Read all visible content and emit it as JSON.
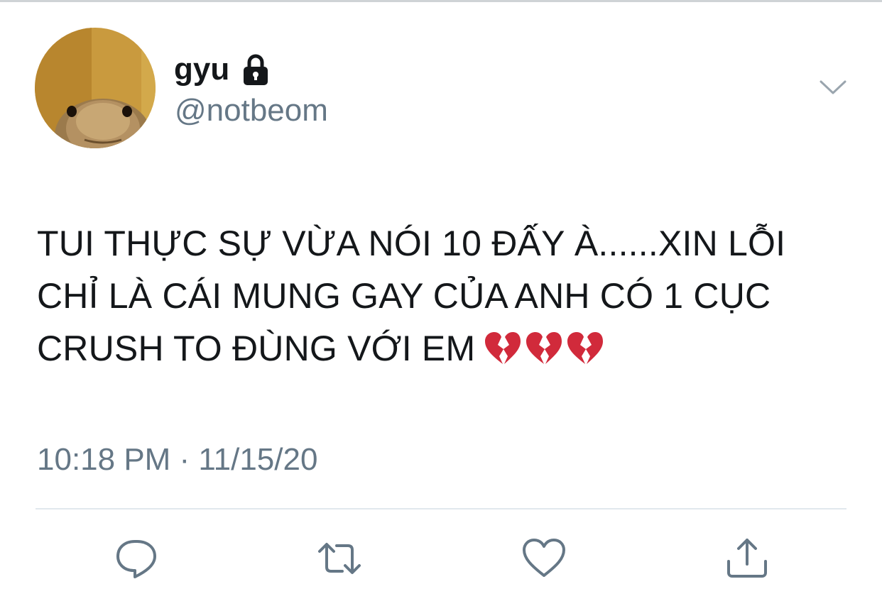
{
  "user": {
    "display_name": "gyu",
    "handle": "@notbeom",
    "protected": true,
    "avatar": "lizard-avatar"
  },
  "tweet": {
    "text": "TUI THỰC SỰ VỪA NÓI 10 ĐẤY À......XIN LỖI\nCHỈ LÀ CÁI MUNG GAY CỦA ANH CÓ 1 CỤC\nCRUSH TO ĐÙNG VỚI EM",
    "emojis": [
      "💔",
      "💔",
      "💔"
    ],
    "timestamp": "10:18 PM · 11/15/20"
  },
  "actions": [
    {
      "name": "reply",
      "icon": "reply-icon"
    },
    {
      "name": "retweet",
      "icon": "retweet-icon"
    },
    {
      "name": "like",
      "icon": "heart-icon"
    },
    {
      "name": "share",
      "icon": "share-icon"
    }
  ],
  "colors": {
    "text": "#14171a",
    "secondary": "#657786",
    "divider": "#e1e8ed",
    "heart": "#d12a3b"
  }
}
